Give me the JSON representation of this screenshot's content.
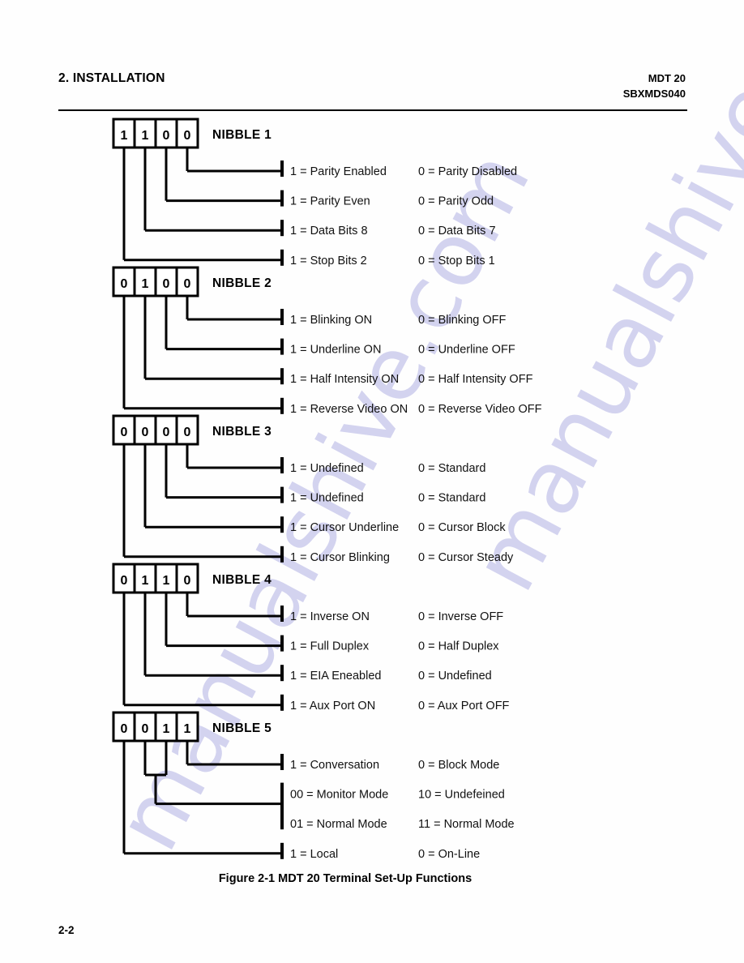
{
  "header": {
    "chapter": "2.  INSTALLATION",
    "product": "MDT 20",
    "doc_number": "SBXMDS040"
  },
  "watermark": {
    "text": "manualshive.com",
    "color": "#d3d3ef"
  },
  "figure": {
    "caption": "Figure 2-1  MDT 20 Terminal Set-Up Functions",
    "nibbles": [
      {
        "label": "NIBBLE 1",
        "bits": [
          "1",
          "1",
          "0",
          "0"
        ],
        "rows": [
          {
            "left": "1 =  Parity Enabled",
            "right": "0  =  Parity Disabled"
          },
          {
            "left": "1 =  Parity Even",
            "right": "0  =  Parity Odd"
          },
          {
            "left": "1 =  Data Bits 8",
            "right": "0  =  Data Bits 7"
          },
          {
            "left": "1 =  Stop Bits 2",
            "right": "0  =  Stop Bits 1"
          }
        ]
      },
      {
        "label": "NIBBLE 2",
        "bits": [
          "0",
          "1",
          "0",
          "0"
        ],
        "rows": [
          {
            "left": "1 =  Blinking ON",
            "right": "0  =  Blinking OFF"
          },
          {
            "left": "1 =  Underline ON",
            "right": "0  =  Underline OFF"
          },
          {
            "left": "1 =  Half Intensity ON",
            "right": "0  =  Half Intensity OFF"
          },
          {
            "left": "1 =  Reverse Video ON",
            "right": "0  =  Reverse Video OFF"
          }
        ]
      },
      {
        "label": "NIBBLE 3",
        "bits": [
          "0",
          "0",
          "0",
          "0"
        ],
        "rows": [
          {
            "left": "1 =  Undefined",
            "right": "0  =  Standard"
          },
          {
            "left": "1 =  Undefined",
            "right": "0  =  Standard"
          },
          {
            "left": "1 =  Cursor Underline",
            "right": "0  =  Cursor Block"
          },
          {
            "left": "1 =  Cursor Blinking",
            "right": "0  =  Cursor Steady"
          }
        ]
      },
      {
        "label": "NIBBLE 4",
        "bits": [
          "0",
          "1",
          "1",
          "0"
        ],
        "rows": [
          {
            "left": "1 =  Inverse ON",
            "right": "0  =  Inverse OFF"
          },
          {
            "left": "1 =  Full Duplex",
            "right": "0  =  Half Duplex"
          },
          {
            "left": "1 =  EIA Eneabled",
            "right": "0  =  Undefined"
          },
          {
            "left": "1 =  Aux Port ON",
            "right": "0  =  Aux Port OFF"
          }
        ]
      },
      {
        "label": "NIBBLE 5",
        "bits": [
          "0",
          "0",
          "1",
          "1"
        ],
        "rows": [
          {
            "left": "1 =  Conversation",
            "right": "0  =  Block Mode"
          },
          {
            "left": "00 =  Monitor Mode",
            "right": "10  =  Undefeined"
          },
          {
            "left": "01 =  Normal Mode",
            "right": "11  =  Normal Mode"
          },
          {
            "left": "1 =  Local",
            "right": "0  =  On-Line"
          }
        ]
      }
    ]
  },
  "footer": {
    "page_number": "2-2"
  }
}
